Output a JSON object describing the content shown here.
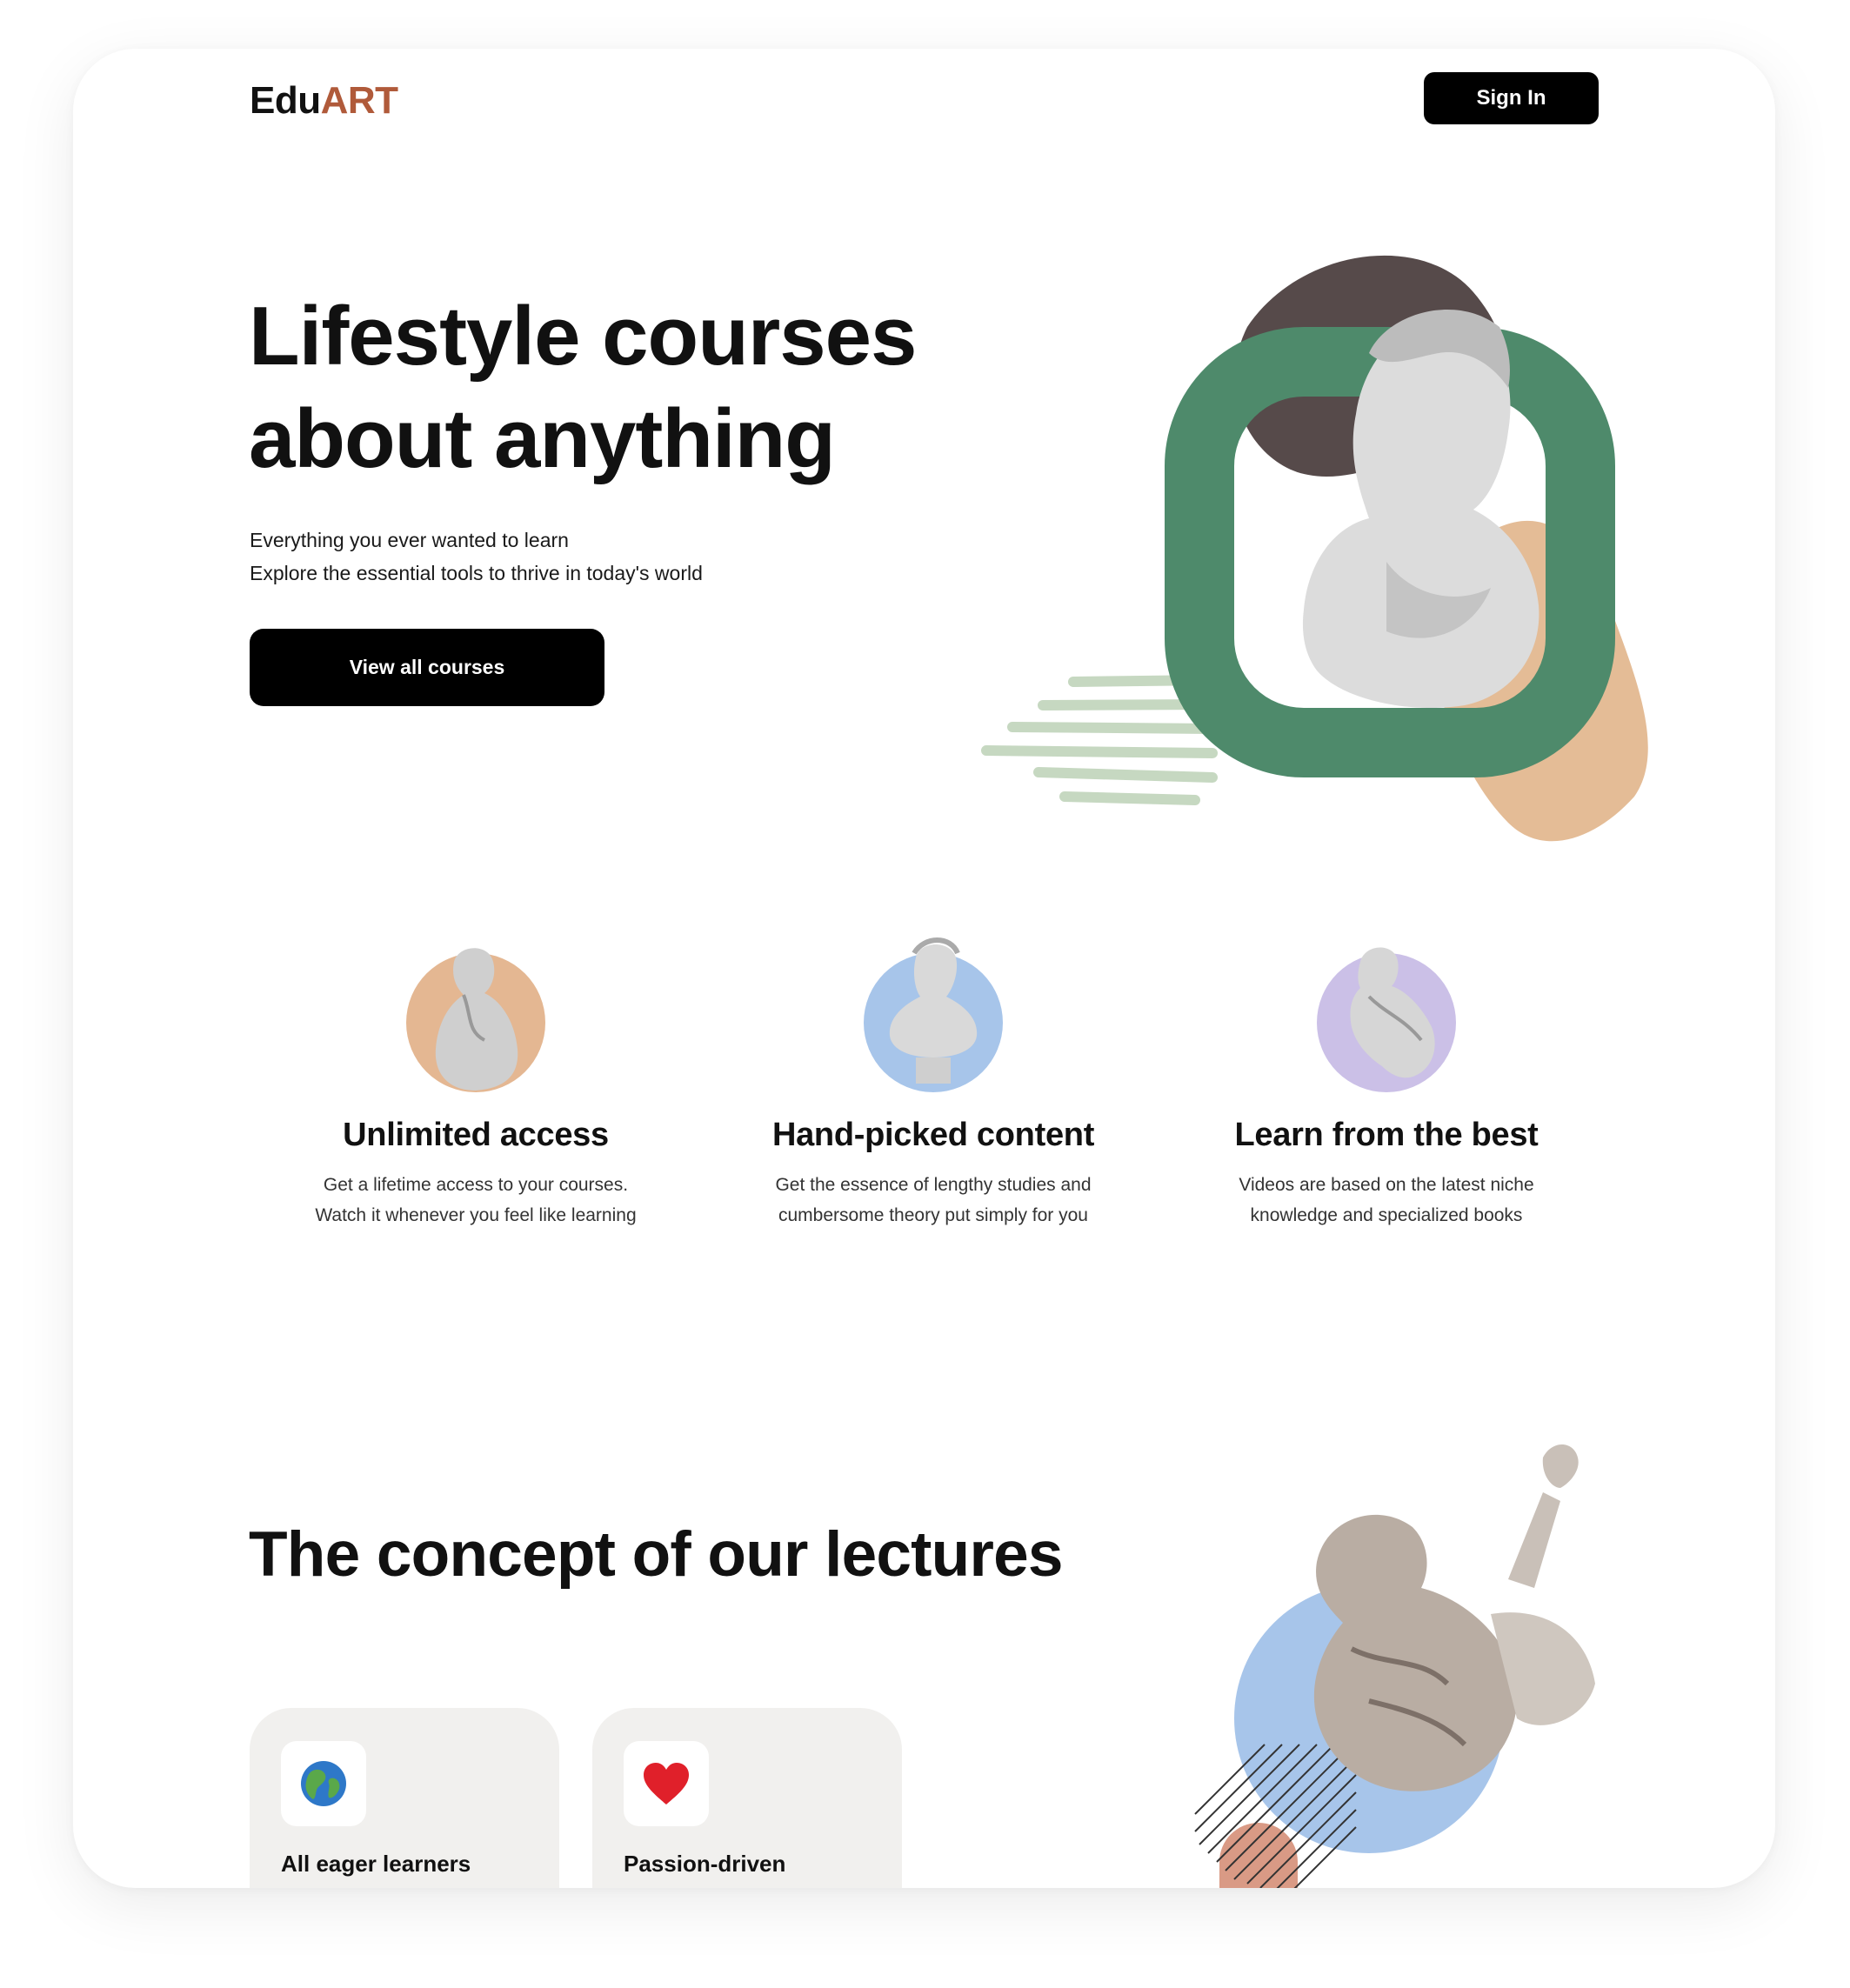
{
  "header": {
    "logo_part1": "Edu",
    "logo_part2": "ART",
    "signin_label": "Sign In"
  },
  "hero": {
    "title_line1": "Lifestyle courses",
    "title_line2": "about anything",
    "subtitle_line1": "Everything you ever wanted to learn",
    "subtitle_line2": "Explore the essential tools to thrive in today's world",
    "cta_label": "View all courses"
  },
  "features": [
    {
      "title": "Unlimited access",
      "desc_line1": "Get a lifetime access to your courses.",
      "desc_line2": "Watch it whenever you feel like learning",
      "avatar_color": "#e4b792"
    },
    {
      "title": "Hand-picked content",
      "desc_line1": "Get the essence of lengthy studies and",
      "desc_line2": "cumbersome theory put simply for you",
      "avatar_color": "#a7c5ea"
    },
    {
      "title": "Learn from the best",
      "desc_line1": "Videos are based on the latest niche",
      "desc_line2": "knowledge and specialized books",
      "avatar_color": "#cbc0e7"
    }
  ],
  "concept": {
    "title": "The concept of our lectures",
    "cards": [
      {
        "label": "All eager learners",
        "icon": "globe-icon"
      },
      {
        "label": "Passion-driven",
        "icon": "heart-icon"
      }
    ]
  },
  "colors": {
    "accent": "#b05a3a",
    "green": "#4e8a6b",
    "dark_blob": "#564a4a",
    "peach": "#e4bc96",
    "blue": "#a7c5ea"
  }
}
